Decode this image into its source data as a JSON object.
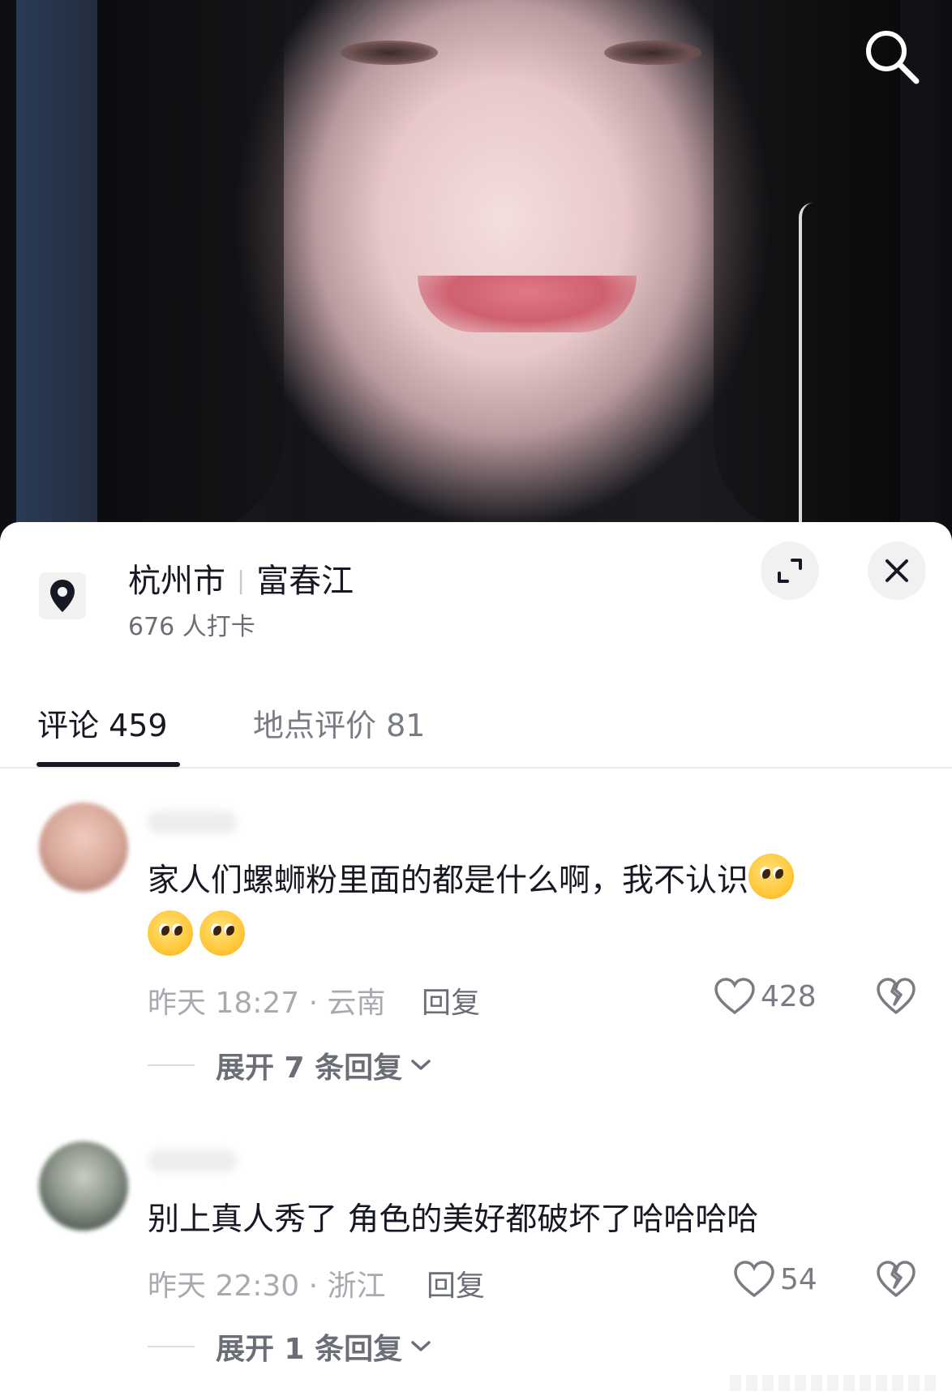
{
  "video": {
    "image_description": "close-up of smiling young woman with long black hair and white earphones",
    "search_icon": "search-icon"
  },
  "location": {
    "city": "杭州市",
    "place": "富春江",
    "checkins": "676 人打卡",
    "pin_icon": "location-pin-icon",
    "expand_icon": "expand-icon",
    "close_icon": "close-icon"
  },
  "tabs": [
    {
      "label": "评论 459",
      "active": true
    },
    {
      "label": "地点评价 81",
      "active": false
    }
  ],
  "comments": [
    {
      "text": "家人们螺蛳粉里面的都是什么啊，我不认识",
      "emoji_count": 3,
      "time_loc": "昨天 18:27 · 云南",
      "reply_label": "回复",
      "likes": "428",
      "expand_label": "展开 7 条回复"
    },
    {
      "text": "别上真人秀了 角色的美好都破坏了哈哈哈哈",
      "emoji_count": 0,
      "time_loc": "昨天 22:30 · 浙江",
      "reply_label": "回复",
      "likes": "54",
      "expand_label": "展开 1 条回复"
    }
  ],
  "colors": {
    "primary_text": "#161823",
    "secondary_text": "#6b6e77",
    "meta_text": "#a8aab0",
    "background": "#ffffff"
  }
}
